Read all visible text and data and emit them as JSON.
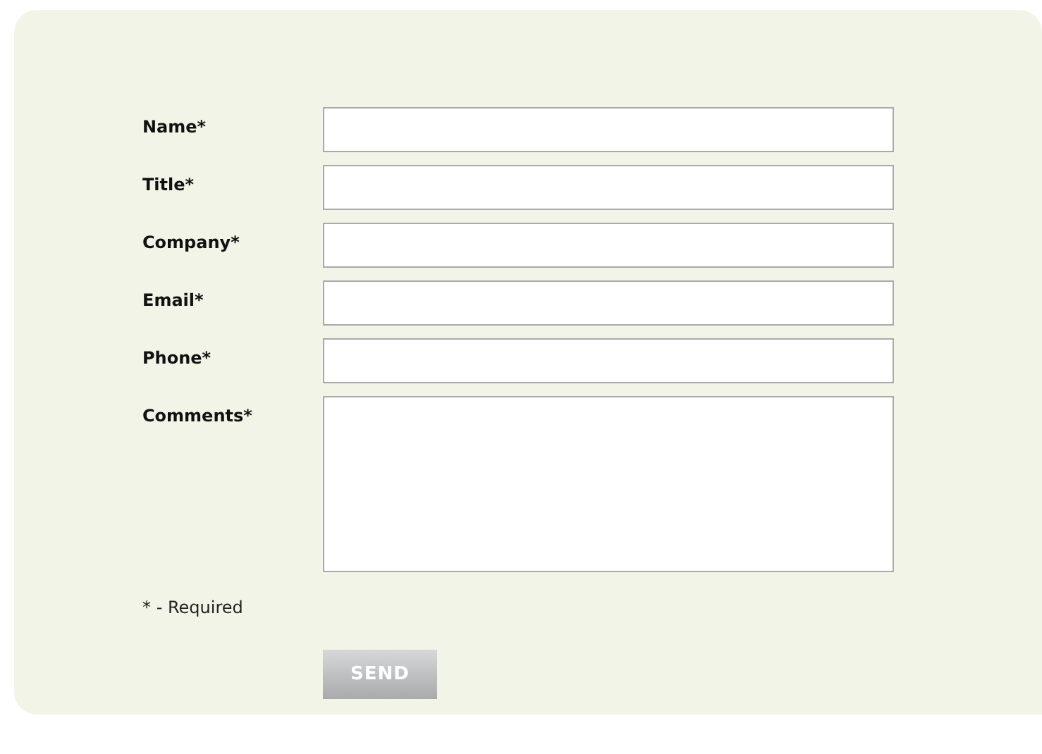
{
  "form": {
    "fields": [
      {
        "label": "Name*",
        "kind": "text"
      },
      {
        "label": "Title*",
        "kind": "text"
      },
      {
        "label": "Company*",
        "kind": "text"
      },
      {
        "label": "Email*",
        "kind": "text"
      },
      {
        "label": "Phone*",
        "kind": "text"
      },
      {
        "label": "Comments*",
        "kind": "textarea"
      }
    ],
    "note": "* - Required",
    "submit": "SEND"
  }
}
